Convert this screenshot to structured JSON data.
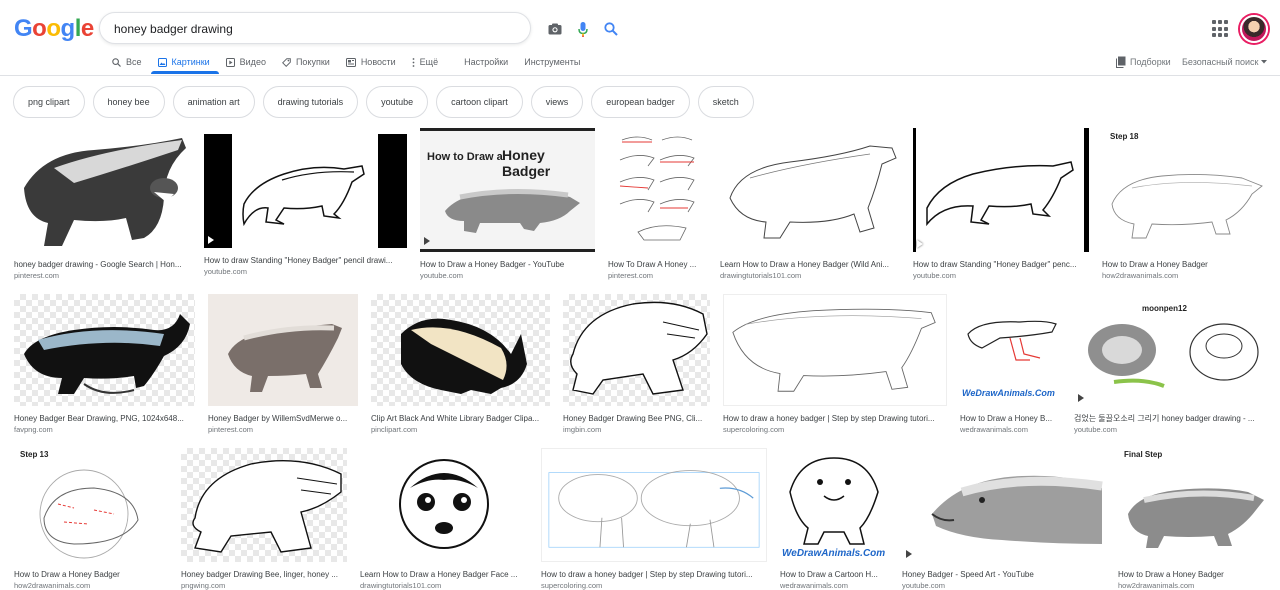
{
  "logo": {
    "letters": [
      "G",
      "o",
      "o",
      "g",
      "l",
      "e"
    ],
    "colors": [
      "#4285F4",
      "#EA4335",
      "#FBBC05",
      "#4285F4",
      "#34A853",
      "#EA4335"
    ]
  },
  "search": {
    "query": "honey badger drawing"
  },
  "tabs": [
    {
      "label": "Все",
      "icon": "search-icon",
      "active": false
    },
    {
      "label": "Картинки",
      "icon": "image-icon",
      "active": true
    },
    {
      "label": "Видео",
      "icon": "video-icon",
      "active": false
    },
    {
      "label": "Покупки",
      "icon": "tag-icon",
      "active": false
    },
    {
      "label": "Новости",
      "icon": "news-icon",
      "active": false
    },
    {
      "label": "Ещё",
      "icon": "more-vert-icon",
      "active": false
    },
    {
      "label": "Настройки",
      "icon": "",
      "active": false
    },
    {
      "label": "Инструменты",
      "icon": "",
      "active": false
    }
  ],
  "header_right": {
    "collections": "Подборки",
    "safesearch": "Безопасный поиск"
  },
  "chips": [
    "png clipart",
    "honey bee",
    "animation art",
    "drawing tutorials",
    "youtube",
    "cartoon clipart",
    "views",
    "european badger",
    "sketch"
  ],
  "results": [
    {
      "title": "honey badger drawing - Google Search | Hon...",
      "source": "pinterest.com"
    },
    {
      "title": "How to draw Standing \"Honey Badger\" pencil drawi...",
      "source": "youtube.com"
    },
    {
      "title": "How to Draw a Honey Badger - YouTube",
      "source": "youtube.com",
      "overlay": "How to Draw a",
      "overlay2": "Honey Badger"
    },
    {
      "title": "How To Draw A Honey ...",
      "source": "pinterest.com"
    },
    {
      "title": "Learn How to Draw a Honey Badger (Wild Ani...",
      "source": "drawingtutorials101.com"
    },
    {
      "title": "How to draw Standing \"Honey Badger\" penc...",
      "source": "youtube.com"
    },
    {
      "title": "How to Draw a Honey Badger",
      "source": "how2drawanimals.com",
      "overlay": "Step 18"
    },
    {
      "title": "Honey Badger Bear Drawing, PNG, 1024x648...",
      "source": "favpng.com"
    },
    {
      "title": "Honey Badger by WillemSvdMerwe o...",
      "source": "pinterest.com"
    },
    {
      "title": "Clip Art Black And White Library Badger Clipa...",
      "source": "pinclipart.com"
    },
    {
      "title": "Honey Badger Drawing Bee PNG, Cli...",
      "source": "imgbin.com"
    },
    {
      "title": "How to draw a honey badger | Step by step Drawing tutori...",
      "source": "supercoloring.com"
    },
    {
      "title": "How to Draw a Honey B...",
      "source": "wedrawanimals.com",
      "overlay": "WeDrawAnimals.Com"
    },
    {
      "title": "검었는 둘끌오소리 그리기 honey badger drawing - ...",
      "source": "youtube.com",
      "overlay": "moonpen12"
    },
    {
      "title": "How to Draw a Honey Badger",
      "source": "how2drawanimals.com",
      "overlay": "Step 13"
    },
    {
      "title": "Honey badger Drawing Bee, linger, honey ...",
      "source": "pngwing.com"
    },
    {
      "title": "Learn How to Draw a Honey Badger Face ...",
      "source": "drawingtutorials101.com"
    },
    {
      "title": "How to draw a honey badger | Step by step Drawing tutori...",
      "source": "supercoloring.com"
    },
    {
      "title": "How to Draw a Cartoon H...",
      "source": "wedrawanimals.com",
      "overlay": "WeDrawAnimals.Com"
    },
    {
      "title": "Honey Badger - Speed Art - YouTube",
      "source": "youtube.com"
    },
    {
      "title": "How to Draw a Honey Badger",
      "source": "how2drawanimals.com",
      "overlay": "Final Step"
    }
  ]
}
